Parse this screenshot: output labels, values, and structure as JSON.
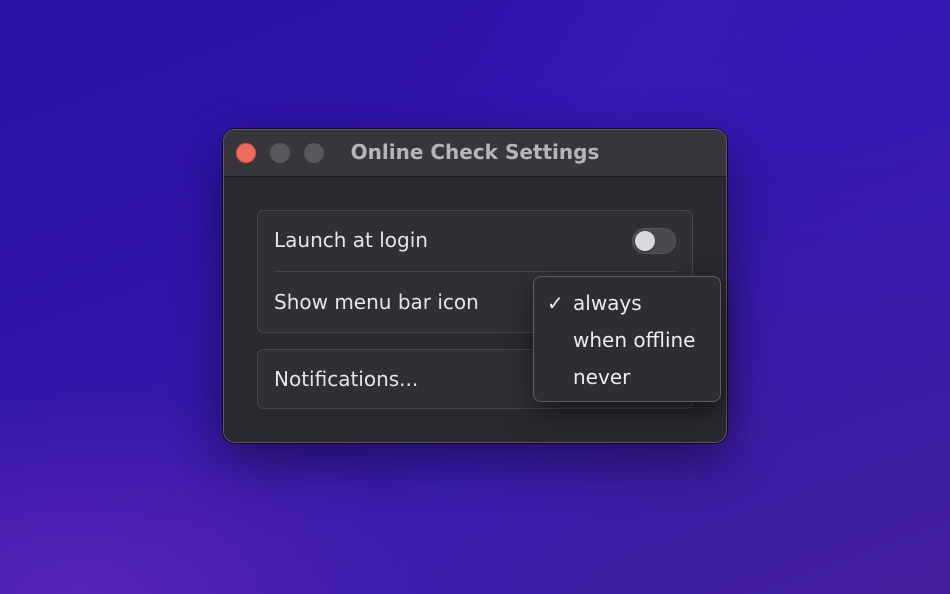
{
  "window": {
    "title": "Online Check Settings"
  },
  "settings": {
    "launch_at_login": {
      "label": "Launch at login",
      "enabled": false
    },
    "menu_bar_icon": {
      "label": "Show menu bar icon",
      "selected": "always",
      "options": [
        "always",
        "when offline",
        "never"
      ]
    },
    "notifications": {
      "label": "Notifications..."
    }
  },
  "icons": {
    "checkmark": "✓"
  },
  "colors": {
    "close_button": "#ed6a5e",
    "window_background": "#2b2930",
    "wallpaper": "#2f15aa"
  }
}
